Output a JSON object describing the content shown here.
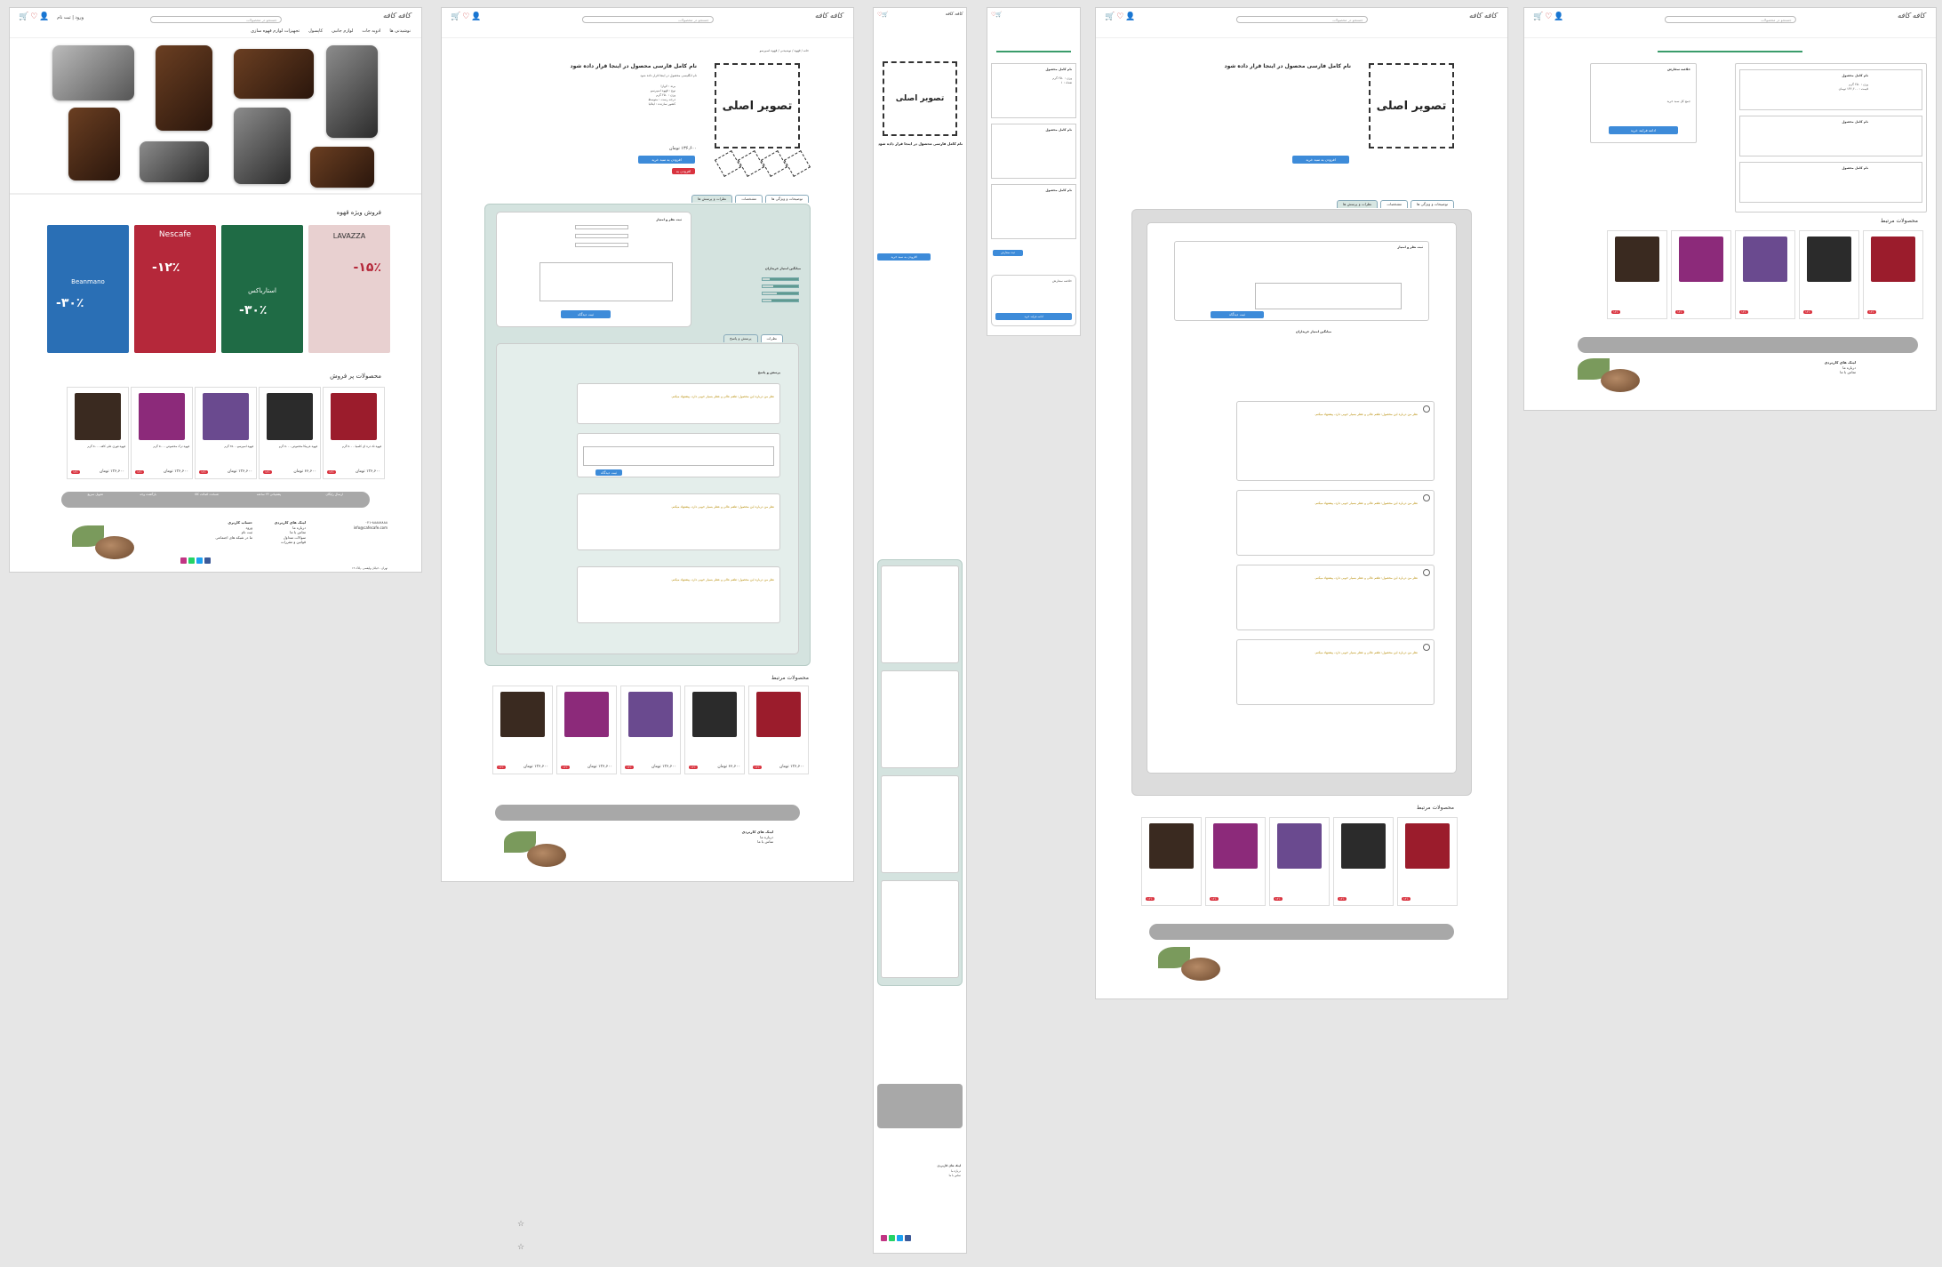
{
  "header": {
    "logo": "کافه کافه",
    "login": "ورود | ثبت نام",
    "search_placeholder": "جستجو در محصولات",
    "icons": [
      "cart-icon",
      "heart-icon",
      "user-icon"
    ],
    "nav": [
      "نوشیدنی ها",
      "ادویه جات",
      "لوازم جانبی",
      "کاپسول",
      "تجهیزات لوازم قهوه سازی"
    ]
  },
  "home": {
    "special_title": "فروش ویژه قهوه",
    "banners": [
      {
        "brand": "LAVAZZA",
        "name": "لاوازا",
        "pct": "۱۵٪-",
        "color": "#d05a5a"
      },
      {
        "brand": "Starbucks",
        "name": "استارباکس",
        "pct": "۳۰٪-",
        "color": "#1f6b45"
      },
      {
        "brand": "Nescafe",
        "name": "نسکافه",
        "pct": "۱۲٪-",
        "color": "#b5283a"
      },
      {
        "brand": "Beanmano",
        "name": "بن مانو",
        "pct": "۳۰٪-",
        "color": "#2a6fb5"
      }
    ],
    "bestsellers_title": "محصولات پر فروش"
  },
  "products": [
    {
      "title": "قهوه تک ذره ای کلمبیا - ۵۰۰ گرم",
      "price": "۱۳۶,۶۰۰ تومان",
      "off": "۱۲٪",
      "color": "#9b1c2c"
    },
    {
      "title": "قهوه عربیکا مخصوص - ۵۰۰ گرم",
      "price": "۶۶,۶۰۰ تومان",
      "off": "۱۲٪",
      "color": "#2b2b2b"
    },
    {
      "title": "قهوه اسپرسو - ۲۵۰ گرم",
      "price": "۱۳۶,۶۰۰ تومان",
      "off": "۱۲٪",
      "color": "#6a4a8f"
    },
    {
      "title": "قهوه ترک مخصوص - ۵۰۰ گرم",
      "price": "۱۳۶,۶۰۰ تومان",
      "off": "۱۲٪",
      "color": "#8c2a7a"
    },
    {
      "title": "قهوه فوری علی کافه - ۵۰۰ گرم",
      "price": "۱۳۶,۶۰۰ تومان",
      "off": "۱۲٪",
      "color": "#3a2a20"
    }
  ],
  "product_page": {
    "breadcrumb": "خانه / قهوه / نوشیدنی / قهوه اسپرسو",
    "main_image": "تصویر اصلی",
    "title": "نام کامل فارسی محصول در اینجا قرار داده شود",
    "subtitle": "نام انگلیسی محصول در اینجا قرار داده شود",
    "details": [
      "برند : لاوازا",
      "نوع : قهوه اسپرسو",
      "وزن : ۲۵۰ گرم",
      "درجه رست : متوسط",
      "کشور سازنده : ایتالیا"
    ],
    "price_old": "۱۴۳,۰۰۰",
    "price": "۱۳۶,۶۰۰ تومان",
    "add_to_cart": "افزودن به سبد خرید",
    "wishlist": "افزودن به علاقه مندی",
    "tabs": [
      "توضیحات و ویژگی ها",
      "مشخصات",
      "نظرات و پرسش ها"
    ],
    "subtabs": [
      "نظرات",
      "پرسش و پاسخ"
    ],
    "review_form_title": "ثبت نظر و امتیاز",
    "submit": "ثبت دیدگاه",
    "rating_title": "میانگین امتیاز خریداران",
    "rating_labels": [
      "عطر",
      "طعم",
      "کیفیت",
      "ارزش خرید"
    ],
    "rating_values": [
      0.8,
      0.7,
      0.6,
      0.75
    ],
    "qa_title": "پرسش و پاسخ",
    "review_text": "نظر من درباره این محصول: طعم عالی و عطر بسیار خوبی دارد، پیشنهاد میکنم.",
    "related_title": "محصولات مرتبط"
  },
  "cart": {
    "title": "سبد خرید",
    "item_title": "نام کامل محصول",
    "item_lines": [
      "وزن : ۲۵۰ گرم",
      "تعداد : ۱",
      "قیمت : ۱۳۶,۶۰۰ تومان"
    ],
    "summary_title": "خلاصه سفارش",
    "total_label": "جمع کل سبد خرید",
    "checkout": "ادامه فرایند خرید",
    "continue": "ثبت سفارش"
  },
  "footer": {
    "features": [
      "ارسال رایگان",
      "پشتیبانی ۲۴ ساعته",
      "ضمانت اصالت کالا",
      "بازگشت وجه",
      "تحویل سریع"
    ],
    "links_title": "لینک های کاربردی",
    "links": [
      "درباره ما",
      "تماس با ما",
      "سوالات متداول",
      "قوانین و مقررات",
      "حریم خصوصی"
    ],
    "account_title": "حساب کاربری",
    "account_links": [
      "ورود",
      "ثبت نام",
      "سبد خرید",
      "علاقه مندی ها"
    ],
    "social_title": "ما در شبکه های اجتماعی",
    "phone": "۰۲۱-۸۸۸۸۸۸۸۸",
    "email": "info@cafecafe.com",
    "address": "تهران - خیابان ولیعصر - پلاک ۱۲"
  }
}
